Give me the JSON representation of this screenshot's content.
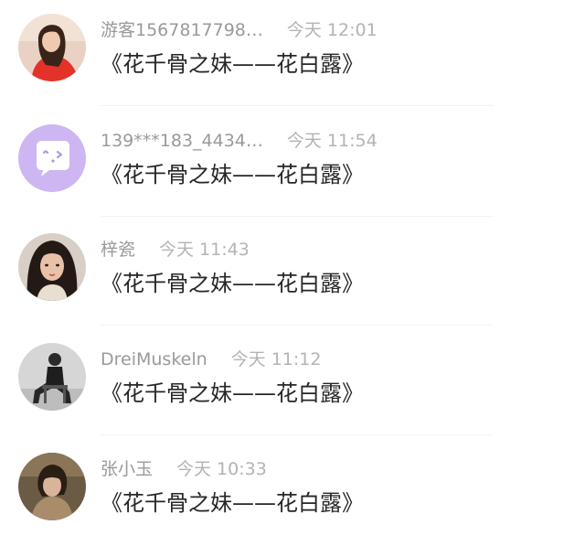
{
  "comments": [
    {
      "name": "游客1567817798…",
      "time": "今天 12:01",
      "text": "《花千骨之妹——花白露》",
      "avatar": "photo-avatar-woman-red-top"
    },
    {
      "name": "139***183_4434…",
      "time": "今天 11:54",
      "text": "《花千骨之妹——花白露》",
      "avatar": "default-chat-bubble-avatar"
    },
    {
      "name": "梓瓷",
      "time": "今天 11:43",
      "text": "《花千骨之妹——花白露》",
      "avatar": "photo-avatar-woman-dark-hair"
    },
    {
      "name": "DreiMuskeln",
      "time": "今天 11:12",
      "text": "《花千骨之妹——花白露》",
      "avatar": "photo-avatar-man-seated-bw"
    },
    {
      "name": "张小玉",
      "time": "今天 10:33",
      "text": "《花千骨之妹——花白露》",
      "avatar": "photo-avatar-woman-brown"
    }
  ],
  "colors": {
    "name_text": "#9a9a9a",
    "time_text": "#b3b3b3",
    "message_text": "#262626",
    "default_avatar_bg": "#cdb6f2",
    "divider": "#f3f3f3"
  }
}
